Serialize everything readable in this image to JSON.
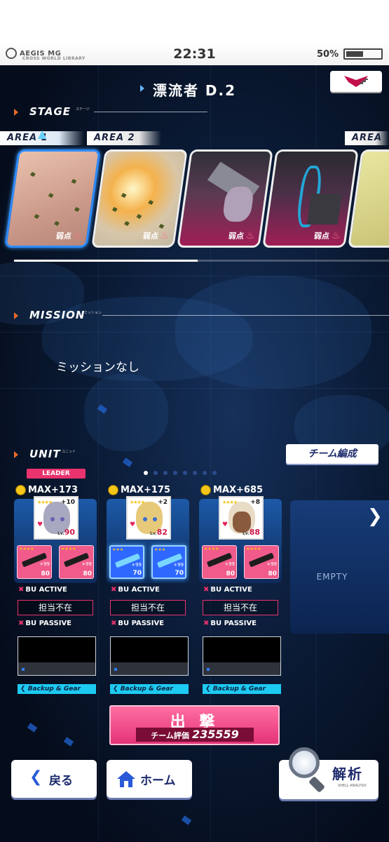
{
  "status_bar": {
    "app_logo": "AEGIS MG",
    "app_logo_sub": "CROSS WORLD LIBRARY",
    "time": "22:31",
    "battery": "50%",
    "battery_level": 0.5
  },
  "header": {
    "title": "漂流者 D.2",
    "menu_icon": "emblem-menu-icon"
  },
  "stage": {
    "label": "STAGE",
    "sub": "ステージ",
    "areas": [
      {
        "label": "AREA 1",
        "weak": "弱点",
        "selected": true
      },
      {
        "label": "AREA 2",
        "weak": "弱点",
        "selected": false
      },
      {
        "label": "",
        "weak": "弱点",
        "selected": false
      },
      {
        "label": "",
        "weak": "弱点",
        "selected": false
      },
      {
        "label": "AREA",
        "weak": "",
        "selected": false
      }
    ],
    "scroll_progress": 0.49
  },
  "mission": {
    "label": "MISSION",
    "sub": "ミッション",
    "text": "ミッションなし"
  },
  "unit": {
    "label": "UNIT",
    "sub": "ユニット",
    "team_button": "チーム編成",
    "leader_badge": "LEADER",
    "page_dots": 8,
    "active_dot": 0,
    "members": [
      {
        "max": "MAX+173",
        "stars": "★★★★",
        "plus": "+10",
        "lv": "90",
        "gears": [
          {
            "stars": "★★★★",
            "plus": "+99",
            "lv": "80"
          },
          {
            "stars": "★★★★",
            "plus": "+99",
            "lv": "80"
          }
        ],
        "bu_active_label": "BU ACTIVE",
        "bu_active_value": "担当不在",
        "bu_passive_label": "BU PASSIVE",
        "backup_label": "Backup & Gear"
      },
      {
        "max": "MAX+175",
        "stars": "★★★★",
        "plus": "+2",
        "lv": "82",
        "gears": [
          {
            "stars": "★★★",
            "plus": "+99",
            "lv": "70"
          },
          {
            "stars": "★★★",
            "plus": "+99",
            "lv": "70"
          }
        ],
        "bu_active_label": "BU ACTIVE",
        "bu_active_value": "担当不在",
        "bu_passive_label": "BU PASSIVE",
        "backup_label": "Backup & Gear"
      },
      {
        "max": "MAX+685",
        "stars": "★★★★",
        "plus": "+8",
        "lv": "88",
        "gears": [
          {
            "stars": "★★★★",
            "plus": "+99",
            "lv": "80"
          },
          {
            "stars": "★★★★",
            "plus": "+99",
            "lv": "80"
          }
        ],
        "bu_active_label": "BU ACTIVE",
        "bu_active_value": "担当不在",
        "bu_passive_label": "BU PASSIVE",
        "backup_label": "Backup & Gear"
      }
    ],
    "empty_label": "EMPTY",
    "lv_prefix": "Lv."
  },
  "sortie": {
    "label": "出 撃",
    "eval_label": "チーム評価",
    "eval_value": "235559"
  },
  "nav": {
    "back": "戻る",
    "home": "ホーム",
    "analysis": "解析",
    "analysis_sub": "SHELL ANALYSIS"
  },
  "colors": {
    "accent_pink": "#e8336e",
    "accent_cyan": "#1dcaf2",
    "navy": "#1d2b6c"
  }
}
